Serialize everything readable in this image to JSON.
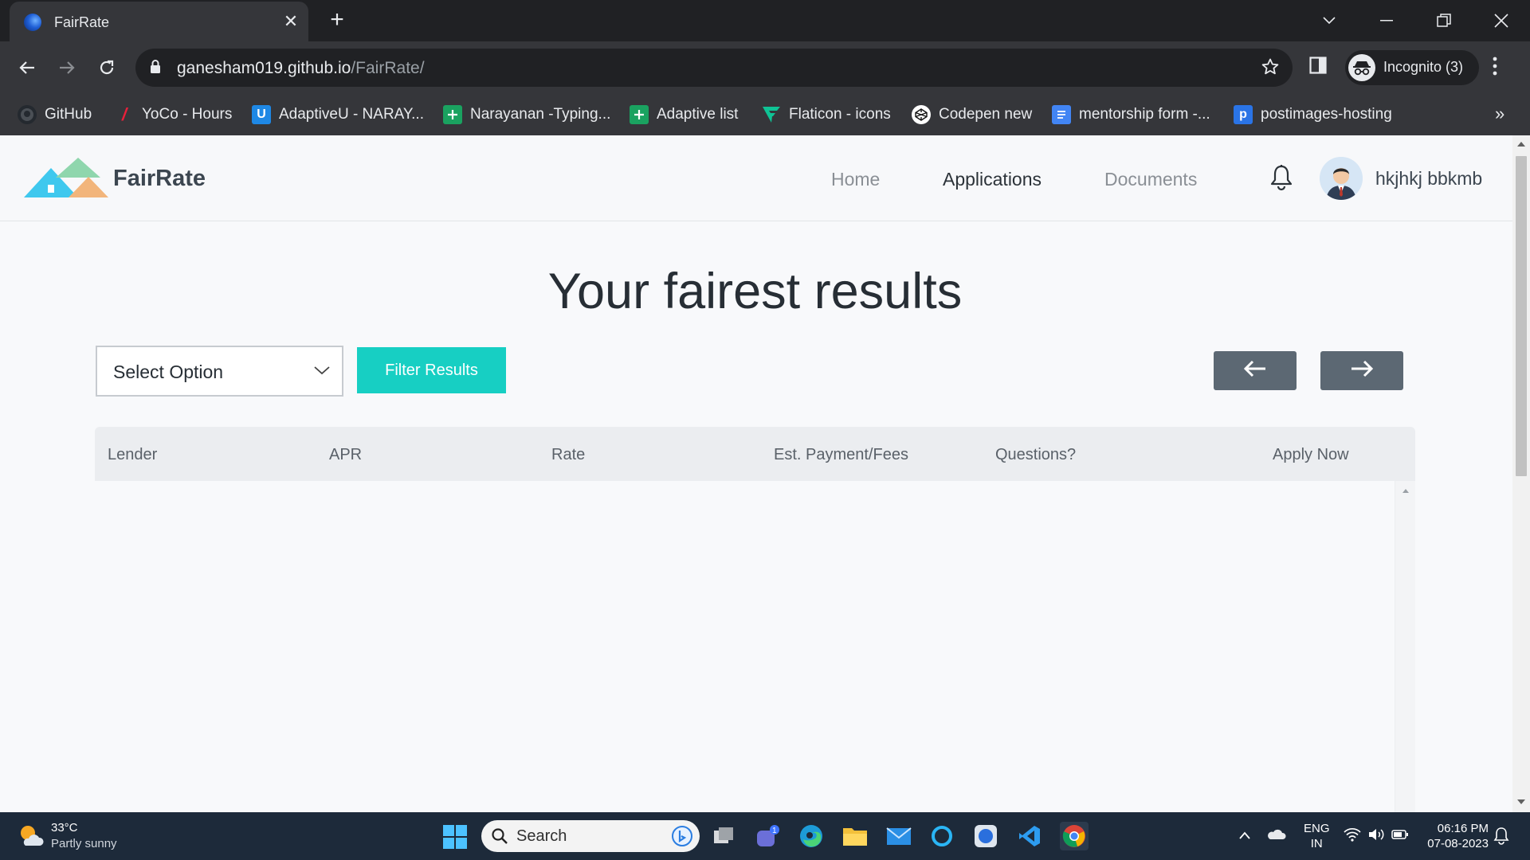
{
  "browser": {
    "tab_title": "FairRate",
    "url_host": "ganesham019.github.io",
    "url_path": "/FairRate/",
    "profile_label": "Incognito (3)",
    "bookmarks": [
      {
        "label": "GitHub",
        "icon": "github-icon"
      },
      {
        "label": "YoCo - Hours",
        "icon": "yoco-icon"
      },
      {
        "label": "AdaptiveU - NARAY...",
        "icon": "adaptiveu-icon"
      },
      {
        "label": "Narayanan -Typing...",
        "icon": "sheets-icon"
      },
      {
        "label": "Adaptive list",
        "icon": "sheets-icon"
      },
      {
        "label": "Flaticon - icons",
        "icon": "flaticon-icon"
      },
      {
        "label": "Codepen new",
        "icon": "codepen-icon"
      },
      {
        "label": "mentorship form -...",
        "icon": "docs-icon"
      },
      {
        "label": "postimages-hosting",
        "icon": "postimages-icon"
      }
    ],
    "more_bookmarks": "»"
  },
  "app": {
    "brand": "FairRate",
    "nav": {
      "home": "Home",
      "applications": "Applications",
      "documents": "Documents"
    },
    "user_name": "hkjhkj bbkmb",
    "title": "Your fairest results",
    "select_value": "Select Option",
    "filter_button": "Filter Results",
    "table_headers": [
      "Lender",
      "APR",
      "Rate",
      "Est. Payment/Fees",
      "Questions?",
      "Apply Now"
    ],
    "colors": {
      "accent": "#17cfc3",
      "nav_button": "#5c6873",
      "title": "#272e35"
    }
  },
  "taskbar": {
    "temperature": "33°C",
    "weather": "Partly sunny",
    "search_placeholder": "Search",
    "lang_line1": "ENG",
    "lang_line2": "IN",
    "time": "06:16 PM",
    "date": "07-08-2023",
    "teams_badge": "1"
  }
}
